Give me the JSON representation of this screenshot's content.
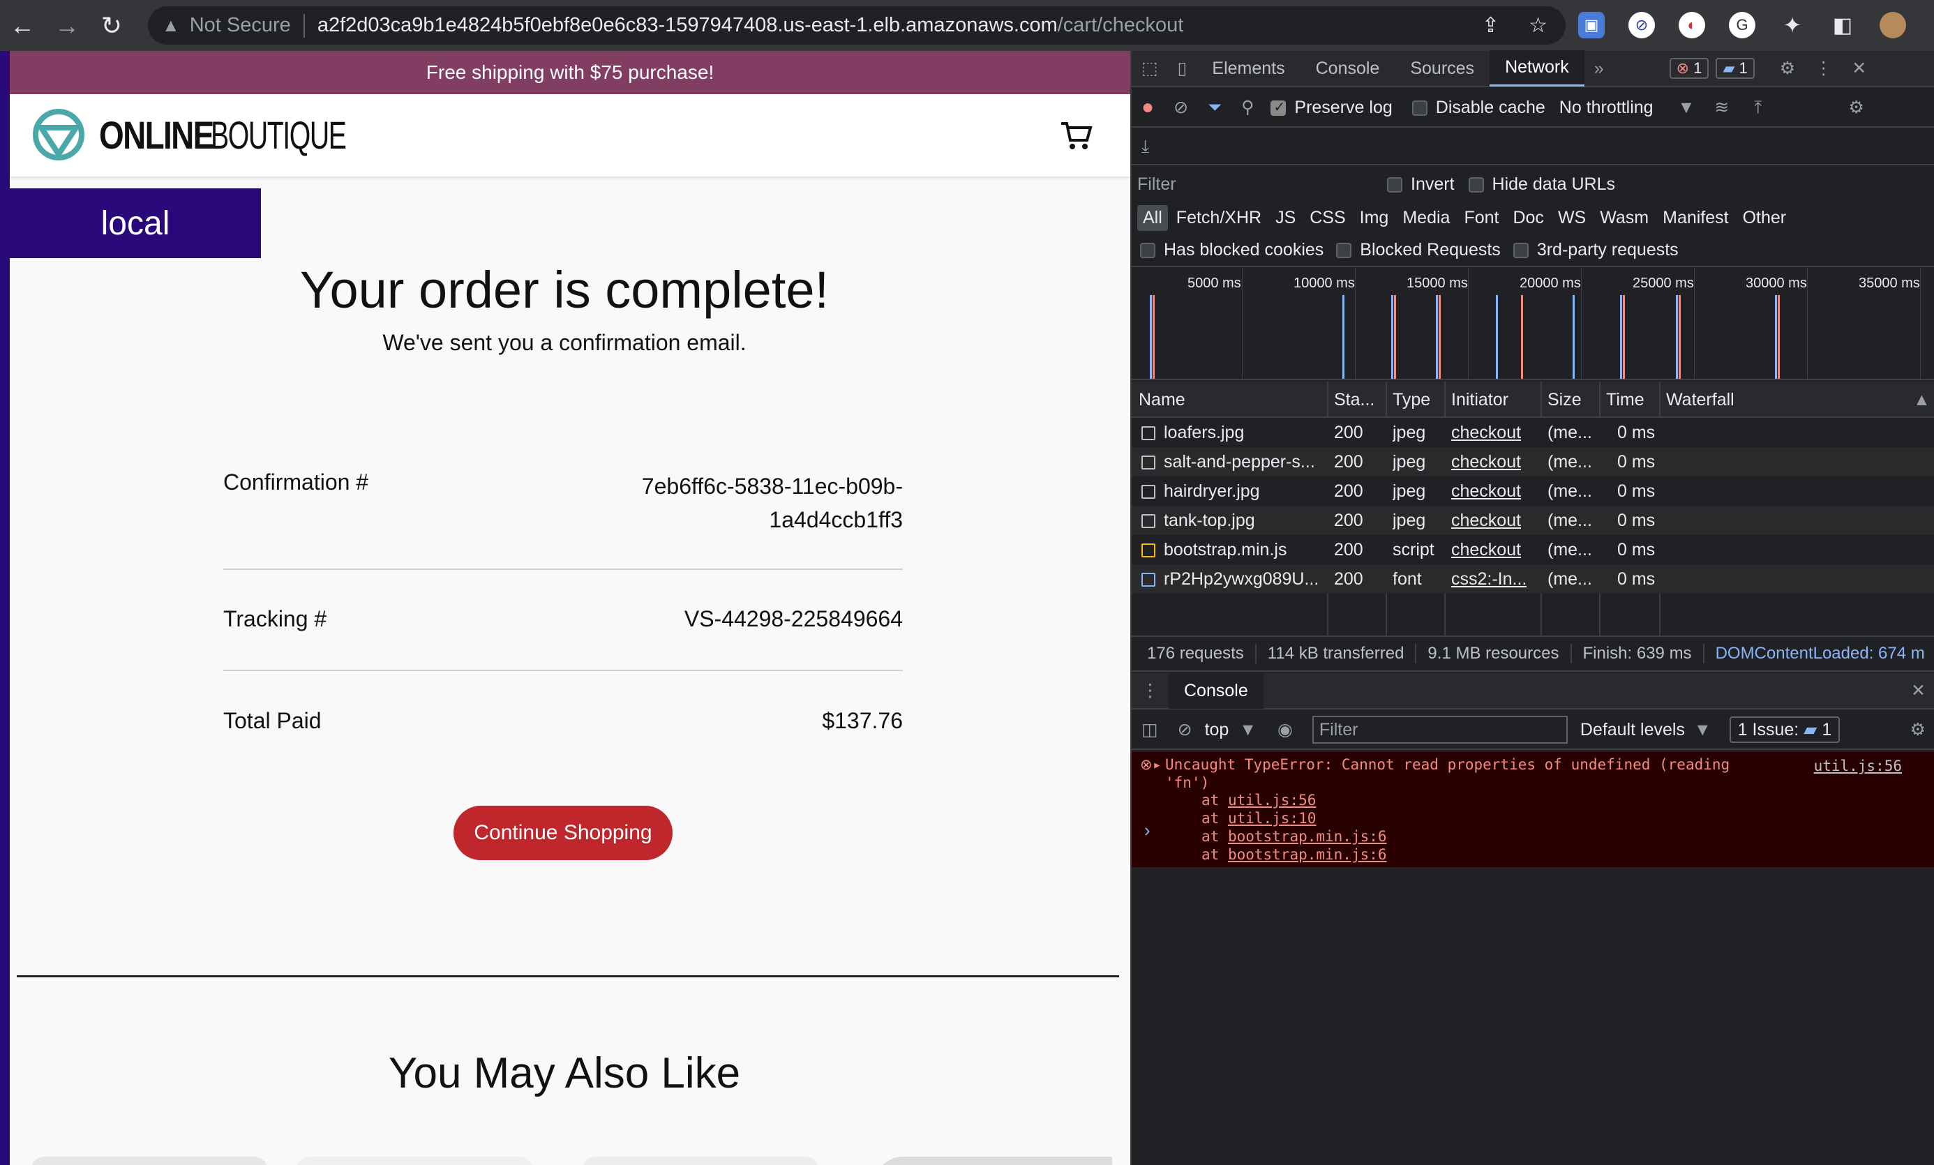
{
  "browser": {
    "security_label": "Not Secure",
    "url_host": "a2f2d03ca9b1e4824b5f0ebf8e0e6c83-1597947408.us-east-1.elb.amazonaws.com",
    "url_path": "/cart/checkout"
  },
  "shop": {
    "promo": "Free shipping with $75 purchase!",
    "logo_bold": "ONLINE",
    "logo_light": "BOUTIQUE",
    "env_badge": "local",
    "title": "Your order is complete!",
    "subtitle": "We've sent you a confirmation email.",
    "confirmation_label": "Confirmation #",
    "confirmation_value_1": "7eb6ff6c-5838-11ec-b09b-",
    "confirmation_value_2": "1a4d4ccb1ff3",
    "tracking_label": "Tracking #",
    "tracking_value": "VS-44298-225849664",
    "total_label": "Total Paid",
    "total_value": "$137.76",
    "continue_label": "Continue Shopping",
    "recommend_title": "You May Also Like"
  },
  "devtools": {
    "tabs": [
      "Elements",
      "Console",
      "Sources",
      "Network"
    ],
    "active_tab": "Network",
    "error_count": "1",
    "message_count": "1",
    "preserve_log": "Preserve log",
    "disable_cache": "Disable cache",
    "throttling": "No throttling",
    "filter_placeholder": "Filter",
    "invert": "Invert",
    "hide_data_urls": "Hide data URLs",
    "type_filters": [
      "All",
      "Fetch/XHR",
      "JS",
      "CSS",
      "Img",
      "Media",
      "Font",
      "Doc",
      "WS",
      "Wasm",
      "Manifest",
      "Other"
    ],
    "has_blocked_cookies": "Has blocked cookies",
    "blocked_requests": "Blocked Requests",
    "third_party": "3rd-party requests",
    "timeline_ticks": [
      "5000 ms",
      "10000 ms",
      "15000 ms",
      "20000 ms",
      "25000 ms",
      "30000 ms",
      "35000 ms"
    ],
    "columns": [
      "Name",
      "Sta...",
      "Type",
      "Initiator",
      "Size",
      "Time",
      "Waterfall"
    ],
    "requests": [
      {
        "name": "loafers.jpg",
        "status": "200",
        "type": "jpeg",
        "initiator": "checkout",
        "size": "(me...",
        "time": "0 ms"
      },
      {
        "name": "salt-and-pepper-s...",
        "status": "200",
        "type": "jpeg",
        "initiator": "checkout",
        "size": "(me...",
        "time": "0 ms"
      },
      {
        "name": "hairdryer.jpg",
        "status": "200",
        "type": "jpeg",
        "initiator": "checkout",
        "size": "(me...",
        "time": "0 ms"
      },
      {
        "name": "tank-top.jpg",
        "status": "200",
        "type": "jpeg",
        "initiator": "checkout",
        "size": "(me...",
        "time": "0 ms"
      },
      {
        "name": "bootstrap.min.js",
        "status": "200",
        "type": "script",
        "initiator": "checkout",
        "size": "(me...",
        "time": "0 ms"
      },
      {
        "name": "rP2Hp2ywxg089U...",
        "status": "200",
        "type": "font",
        "initiator": "css2:-In...",
        "size": "(me...",
        "time": "0 ms"
      }
    ],
    "summary": {
      "requests": "176 requests",
      "transferred": "114 kB transferred",
      "resources": "9.1 MB resources",
      "finish": "Finish: 639 ms",
      "dcl": "DOMContentLoaded: 674 m"
    },
    "drawer_tab": "Console",
    "console_context": "top",
    "console_filter": "Filter",
    "default_levels": "Default levels",
    "issues": "1 Issue:",
    "issues_count": "1",
    "error_line1": "Uncaught TypeError: Cannot read properties of undefined (reading",
    "error_line2": "'fn')",
    "error_location": "util.js:56",
    "stack": [
      "util.js:56",
      "util.js:10",
      "bootstrap.min.js:6",
      "bootstrap.min.js:6"
    ]
  }
}
